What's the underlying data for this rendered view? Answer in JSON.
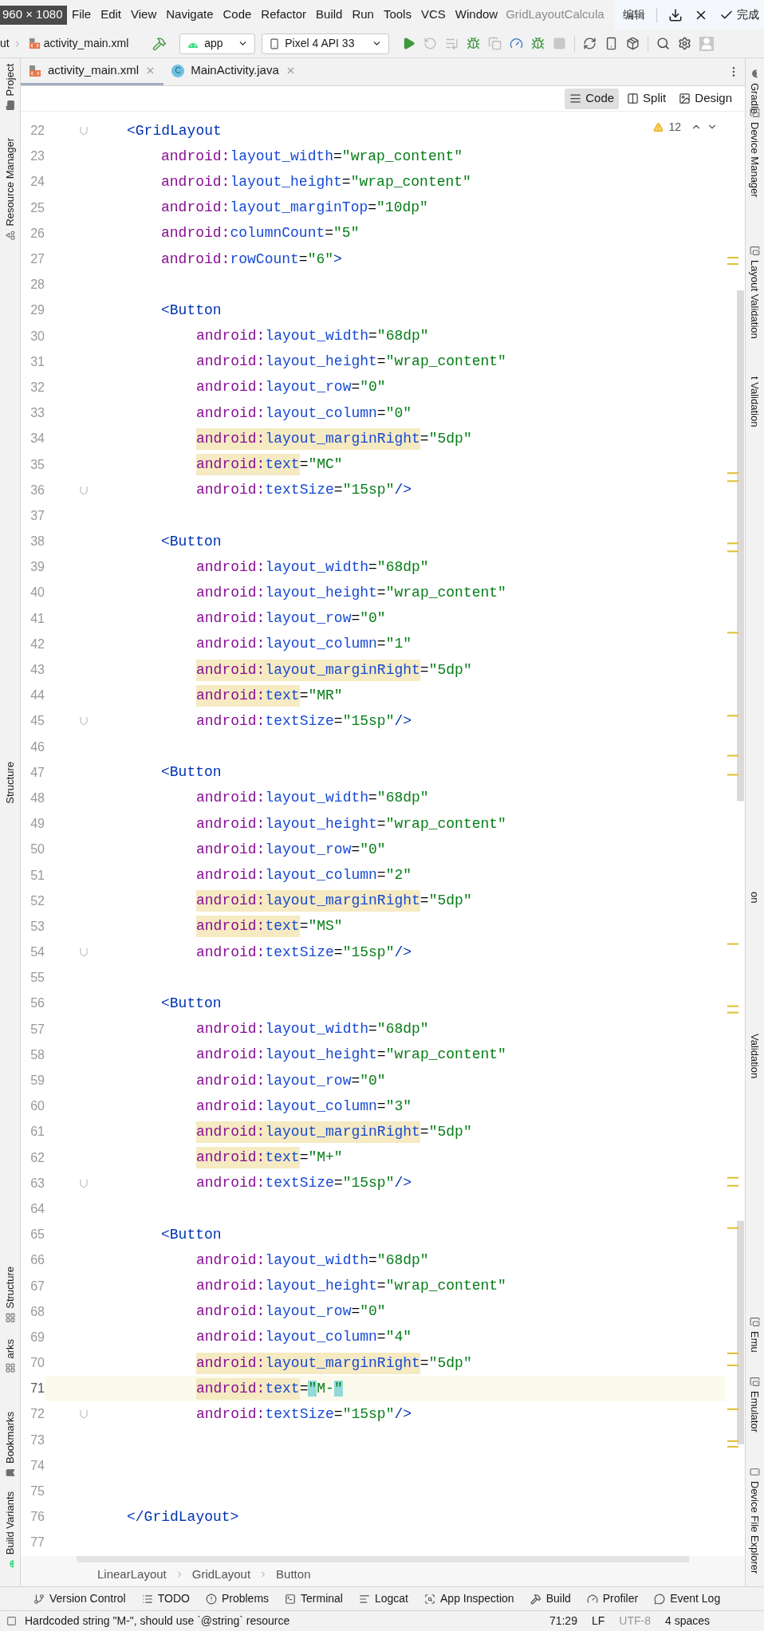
{
  "capture_overlay": {
    "size_label": "960 × 1080",
    "edit_label": "编辑",
    "done_label": "完成"
  },
  "menu": {
    "items": [
      "File",
      "Edit",
      "View",
      "Navigate",
      "Code",
      "Refactor",
      "Build",
      "Run",
      "Tools",
      "VCS",
      "Window"
    ],
    "title": "GridLayoutCalcula"
  },
  "toolbar": {
    "path_fragment": "ut",
    "file": "activity_main.xml",
    "run_config": "app",
    "device": "Pixel 4 API 33"
  },
  "tabs": [
    {
      "label": "activity_main.xml",
      "kind": "xml",
      "selected": true
    },
    {
      "label": "MainActivity.java",
      "kind": "java",
      "icon_text": "C",
      "selected": false
    }
  ],
  "view_modes": [
    {
      "label": "Code",
      "kind": "code",
      "selected": true
    },
    {
      "label": "Split",
      "kind": "split",
      "selected": false
    },
    {
      "label": "Design",
      "kind": "design",
      "selected": false
    }
  ],
  "inspection": {
    "count": "12"
  },
  "left_strip": [
    {
      "label": "Project",
      "kind": "folder"
    },
    {
      "label": "Resource Manager",
      "kind": "shapes"
    },
    {
      "label": "Structure",
      "kind": "text"
    },
    {
      "label": "Structure",
      "kind": "structure"
    },
    {
      "label": "arks",
      "kind": "structure"
    },
    {
      "label": "Bookmarks",
      "kind": "bookmark"
    },
    {
      "label": "Build Variants",
      "kind": "android"
    }
  ],
  "right_strip": [
    {
      "label": "Gradle",
      "kind": "gradle"
    },
    {
      "label": "Device Manager",
      "kind": "device"
    },
    {
      "label": "Layout Validation",
      "kind": "device"
    },
    {
      "label": "t Validation",
      "kind": "text"
    },
    {
      "label": "on",
      "kind": "text"
    },
    {
      "label": "Validation",
      "kind": "text"
    },
    {
      "label": "Emu",
      "kind": "device"
    },
    {
      "label": "Emulator",
      "kind": "device"
    },
    {
      "label": "Device File Explorer",
      "kind": "phone"
    }
  ],
  "code_lines": [
    {
      "number": "22",
      "kind": "container_tag",
      "text": "<GridLayout",
      "fold": true,
      "current": false
    },
    {
      "number": "23",
      "kind": "container_attribute",
      "namespace": "android:",
      "attribute": "layout_width",
      "equals": "=",
      "value": "\"wrap_content\"",
      "highlighted": false,
      "brace_match": false,
      "fold": false,
      "current": false
    },
    {
      "number": "24",
      "kind": "container_attribute",
      "namespace": "android:",
      "attribute": "layout_height",
      "equals": "=",
      "value": "\"wrap_content\"",
      "highlighted": false,
      "brace_match": false,
      "fold": false,
      "current": false
    },
    {
      "number": "25",
      "kind": "container_attribute",
      "namespace": "android:",
      "attribute": "layout_marginTop",
      "equals": "=",
      "value": "\"10dp\"",
      "highlighted": false,
      "brace_match": false,
      "fold": false,
      "current": false
    },
    {
      "number": "26",
      "kind": "container_attribute",
      "namespace": "android:",
      "attribute": "columnCount",
      "equals": "=",
      "value": "\"5\"",
      "highlighted": false,
      "brace_match": false,
      "fold": false,
      "current": false
    },
    {
      "number": "27",
      "kind": "container_attribute",
      "namespace": "android:",
      "attribute": "rowCount",
      "equals": "=",
      "value": "\"6\"",
      "closing": ">",
      "highlighted": false,
      "brace_match": false,
      "fold": false,
      "current": false
    },
    {
      "number": "28",
      "kind": "blank",
      "fold": false,
      "current": false
    },
    {
      "number": "29",
      "kind": "child_tag",
      "text": "<Button",
      "fold": false,
      "current": false
    },
    {
      "number": "30",
      "kind": "child_attribute",
      "namespace": "android:",
      "attribute": "layout_width",
      "equals": "=",
      "value": "\"68dp\"",
      "highlighted": false,
      "brace_match": false,
      "fold": false,
      "current": false
    },
    {
      "number": "31",
      "kind": "child_attribute",
      "namespace": "android:",
      "attribute": "layout_height",
      "equals": "=",
      "value": "\"wrap_content\"",
      "highlighted": false,
      "brace_match": false,
      "fold": false,
      "current": false
    },
    {
      "number": "32",
      "kind": "child_attribute",
      "namespace": "android:",
      "attribute": "layout_row",
      "equals": "=",
      "value": "\"0\"",
      "highlighted": false,
      "brace_match": false,
      "fold": false,
      "current": false
    },
    {
      "number": "33",
      "kind": "child_attribute",
      "namespace": "android:",
      "attribute": "layout_column",
      "equals": "=",
      "value": "\"0\"",
      "highlighted": false,
      "brace_match": false,
      "fold": false,
      "current": false
    },
    {
      "number": "34",
      "kind": "child_attribute",
      "namespace": "android:",
      "attribute": "layout_marginRight",
      "equals": "=",
      "value": "\"5dp\"",
      "highlighted": true,
      "brace_match": false,
      "fold": false,
      "current": false
    },
    {
      "number": "35",
      "kind": "child_attribute",
      "namespace": "android:",
      "attribute": "text",
      "equals": "=",
      "value": "\"MC\"",
      "highlighted": true,
      "brace_match": false,
      "fold": false,
      "current": false
    },
    {
      "number": "36",
      "kind": "child_attribute",
      "namespace": "android:",
      "attribute": "textSize",
      "equals": "=",
      "value": "\"15sp\"",
      "closing": "/>",
      "highlighted": false,
      "brace_match": false,
      "fold": true,
      "current": false
    },
    {
      "number": "37",
      "kind": "blank",
      "fold": false,
      "current": false
    },
    {
      "number": "38",
      "kind": "child_tag",
      "text": "<Button",
      "fold": false,
      "current": false
    },
    {
      "number": "39",
      "kind": "child_attribute",
      "namespace": "android:",
      "attribute": "layout_width",
      "equals": "=",
      "value": "\"68dp\"",
      "highlighted": false,
      "brace_match": false,
      "fold": false,
      "current": false
    },
    {
      "number": "40",
      "kind": "child_attribute",
      "namespace": "android:",
      "attribute": "layout_height",
      "equals": "=",
      "value": "\"wrap_content\"",
      "highlighted": false,
      "brace_match": false,
      "fold": false,
      "current": false
    },
    {
      "number": "41",
      "kind": "child_attribute",
      "namespace": "android:",
      "attribute": "layout_row",
      "equals": "=",
      "value": "\"0\"",
      "highlighted": false,
      "brace_match": false,
      "fold": false,
      "current": false
    },
    {
      "number": "42",
      "kind": "child_attribute",
      "namespace": "android:",
      "attribute": "layout_column",
      "equals": "=",
      "value": "\"1\"",
      "highlighted": false,
      "brace_match": false,
      "fold": false,
      "current": false
    },
    {
      "number": "43",
      "kind": "child_attribute",
      "namespace": "android:",
      "attribute": "layout_marginRight",
      "equals": "=",
      "value": "\"5dp\"",
      "highlighted": true,
      "brace_match": false,
      "fold": false,
      "current": false
    },
    {
      "number": "44",
      "kind": "child_attribute",
      "namespace": "android:",
      "attribute": "text",
      "equals": "=",
      "value": "\"MR\"",
      "highlighted": true,
      "brace_match": false,
      "fold": false,
      "current": false
    },
    {
      "number": "45",
      "kind": "child_attribute",
      "namespace": "android:",
      "attribute": "textSize",
      "equals": "=",
      "value": "\"15sp\"",
      "closing": "/>",
      "highlighted": false,
      "brace_match": false,
      "fold": true,
      "current": false
    },
    {
      "number": "46",
      "kind": "blank",
      "fold": false,
      "current": false
    },
    {
      "number": "47",
      "kind": "child_tag",
      "text": "<Button",
      "fold": false,
      "current": false
    },
    {
      "number": "48",
      "kind": "child_attribute",
      "namespace": "android:",
      "attribute": "layout_width",
      "equals": "=",
      "value": "\"68dp\"",
      "highlighted": false,
      "brace_match": false,
      "fold": false,
      "current": false
    },
    {
      "number": "49",
      "kind": "child_attribute",
      "namespace": "android:",
      "attribute": "layout_height",
      "equals": "=",
      "value": "\"wrap_content\"",
      "highlighted": false,
      "brace_match": false,
      "fold": false,
      "current": false
    },
    {
      "number": "50",
      "kind": "child_attribute",
      "namespace": "android:",
      "attribute": "layout_row",
      "equals": "=",
      "value": "\"0\"",
      "highlighted": false,
      "brace_match": false,
      "fold": false,
      "current": false
    },
    {
      "number": "51",
      "kind": "child_attribute",
      "namespace": "android:",
      "attribute": "layout_column",
      "equals": "=",
      "value": "\"2\"",
      "highlighted": false,
      "brace_match": false,
      "fold": false,
      "current": false
    },
    {
      "number": "52",
      "kind": "child_attribute",
      "namespace": "android:",
      "attribute": "layout_marginRight",
      "equals": "=",
      "value": "\"5dp\"",
      "highlighted": true,
      "brace_match": false,
      "fold": false,
      "current": false
    },
    {
      "number": "53",
      "kind": "child_attribute",
      "namespace": "android:",
      "attribute": "text",
      "equals": "=",
      "value": "\"MS\"",
      "highlighted": true,
      "brace_match": false,
      "fold": false,
      "current": false
    },
    {
      "number": "54",
      "kind": "child_attribute",
      "namespace": "android:",
      "attribute": "textSize",
      "equals": "=",
      "value": "\"15sp\"",
      "closing": "/>",
      "highlighted": false,
      "brace_match": false,
      "fold": true,
      "current": false
    },
    {
      "number": "55",
      "kind": "blank",
      "fold": false,
      "current": false
    },
    {
      "number": "56",
      "kind": "child_tag",
      "text": "<Button",
      "fold": false,
      "current": false
    },
    {
      "number": "57",
      "kind": "child_attribute",
      "namespace": "android:",
      "attribute": "layout_width",
      "equals": "=",
      "value": "\"68dp\"",
      "highlighted": false,
      "brace_match": false,
      "fold": false,
      "current": false
    },
    {
      "number": "58",
      "kind": "child_attribute",
      "namespace": "android:",
      "attribute": "layout_height",
      "equals": "=",
      "value": "\"wrap_content\"",
      "highlighted": false,
      "brace_match": false,
      "fold": false,
      "current": false
    },
    {
      "number": "59",
      "kind": "child_attribute",
      "namespace": "android:",
      "attribute": "layout_row",
      "equals": "=",
      "value": "\"0\"",
      "highlighted": false,
      "brace_match": false,
      "fold": false,
      "current": false
    },
    {
      "number": "60",
      "kind": "child_attribute",
      "namespace": "android:",
      "attribute": "layout_column",
      "equals": "=",
      "value": "\"3\"",
      "highlighted": false,
      "brace_match": false,
      "fold": false,
      "current": false
    },
    {
      "number": "61",
      "kind": "child_attribute",
      "namespace": "android:",
      "attribute": "layout_marginRight",
      "equals": "=",
      "value": "\"5dp\"",
      "highlighted": true,
      "brace_match": false,
      "fold": false,
      "current": false
    },
    {
      "number": "62",
      "kind": "child_attribute",
      "namespace": "android:",
      "attribute": "text",
      "equals": "=",
      "value": "\"M+\"",
      "highlighted": true,
      "brace_match": false,
      "fold": false,
      "current": false
    },
    {
      "number": "63",
      "kind": "child_attribute",
      "namespace": "android:",
      "attribute": "textSize",
      "equals": "=",
      "value": "\"15sp\"",
      "closing": "/>",
      "highlighted": false,
      "brace_match": false,
      "fold": true,
      "current": false
    },
    {
      "number": "64",
      "kind": "blank",
      "fold": false,
      "current": false
    },
    {
      "number": "65",
      "kind": "child_tag",
      "text": "<Button",
      "fold": false,
      "current": false
    },
    {
      "number": "66",
      "kind": "child_attribute",
      "namespace": "android:",
      "attribute": "layout_width",
      "equals": "=",
      "value": "\"68dp\"",
      "highlighted": false,
      "brace_match": false,
      "fold": false,
      "current": false
    },
    {
      "number": "67",
      "kind": "child_attribute",
      "namespace": "android:",
      "attribute": "layout_height",
      "equals": "=",
      "value": "\"wrap_content\"",
      "highlighted": false,
      "brace_match": false,
      "fold": false,
      "current": false
    },
    {
      "number": "68",
      "kind": "child_attribute",
      "namespace": "android:",
      "attribute": "layout_row",
      "equals": "=",
      "value": "\"0\"",
      "highlighted": false,
      "brace_match": false,
      "fold": false,
      "current": false
    },
    {
      "number": "69",
      "kind": "child_attribute",
      "namespace": "android:",
      "attribute": "layout_column",
      "equals": "=",
      "value": "\"4\"",
      "highlighted": false,
      "brace_match": false,
      "fold": false,
      "current": false
    },
    {
      "number": "70",
      "kind": "child_attribute",
      "namespace": "android:",
      "attribute": "layout_marginRight",
      "equals": "=",
      "value": "\"5dp\"",
      "highlighted": true,
      "brace_match": false,
      "fold": false,
      "current": false
    },
    {
      "number": "71",
      "kind": "child_attribute",
      "namespace": "android:",
      "attribute": "text",
      "equals": "=",
      "value": "\"M-\"",
      "highlighted": true,
      "brace_match": true,
      "fold": false,
      "current": true
    },
    {
      "number": "72",
      "kind": "child_attribute",
      "namespace": "android:",
      "attribute": "textSize",
      "equals": "=",
      "value": "\"15sp\"",
      "closing": "/>",
      "highlighted": false,
      "brace_match": false,
      "fold": true,
      "current": false
    },
    {
      "number": "73",
      "kind": "blank",
      "fold": false,
      "current": false
    },
    {
      "number": "74",
      "kind": "blank",
      "fold": false,
      "current": false
    },
    {
      "number": "75",
      "kind": "blank",
      "fold": false,
      "current": false
    },
    {
      "number": "76",
      "kind": "container_tag",
      "text": "</GridLayout>",
      "fold": false,
      "current": false
    },
    {
      "number": "77",
      "kind": "blank",
      "fold": false,
      "current": false
    }
  ],
  "breadcrumbs": [
    "LinearLayout",
    "GridLayout",
    "Button"
  ],
  "tool_windows": [
    {
      "label": "Version Control",
      "kind": "branch"
    },
    {
      "label": "TODO",
      "kind": "list"
    },
    {
      "label": "Problems",
      "kind": "alert"
    },
    {
      "label": "Terminal",
      "kind": "terminal"
    },
    {
      "label": "Logcat",
      "kind": "log"
    },
    {
      "label": "App Inspection",
      "kind": "inspect"
    },
    {
      "label": "Build",
      "kind": "hammer"
    },
    {
      "label": "Profiler",
      "kind": "gauge"
    },
    {
      "label": "Event Log",
      "kind": "bubble"
    }
  ],
  "status_bar": {
    "message": "Hardcoded string \"M-\", should use `@string` resource",
    "position": "71:29",
    "line_separator": "LF",
    "encoding": "UTF-8",
    "indent": "4 spaces"
  }
}
